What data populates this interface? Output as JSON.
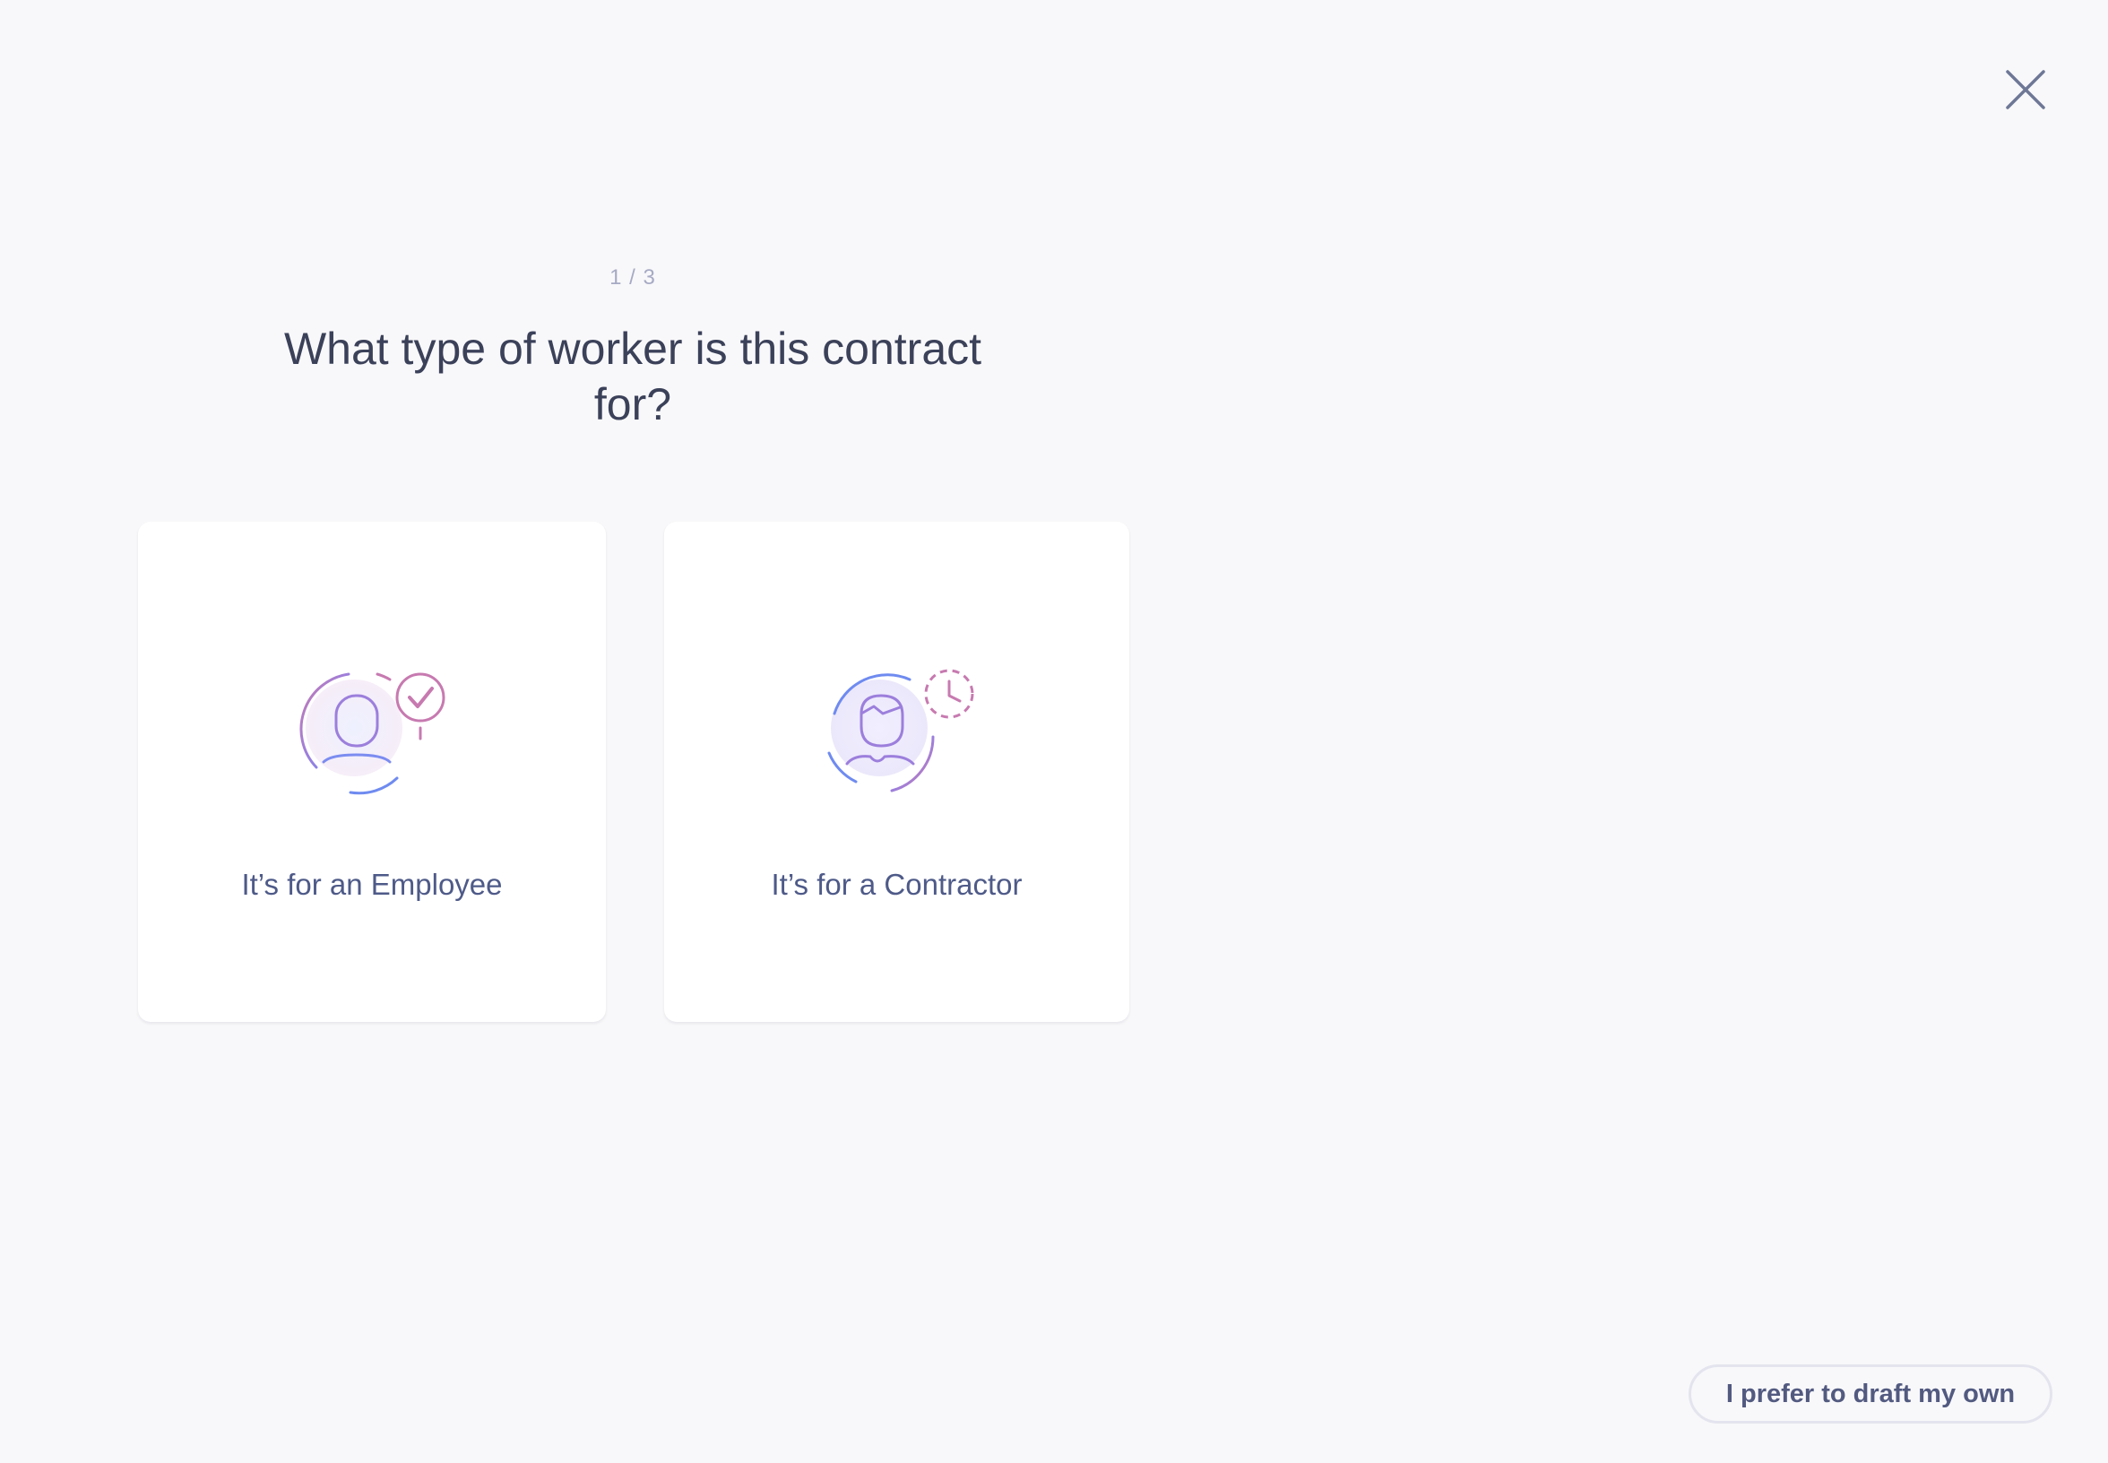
{
  "wizard": {
    "step_counter": "1 / 3",
    "title": "What type of worker is this contract for?"
  },
  "options": [
    {
      "label": "It’s for an Employee",
      "icon": "employee-check-icon"
    },
    {
      "label": "It’s for a Contractor",
      "icon": "contractor-clock-icon"
    }
  ],
  "footer": {
    "draft_own_label": "I prefer to draft my own"
  },
  "icons": {
    "close": "close-icon"
  },
  "colors": {
    "background": "#f8f8fa",
    "title": "#3b4159",
    "label": "#4e5a88",
    "accent_blue": "#7b8cf0",
    "accent_pink": "#c77ab0"
  }
}
